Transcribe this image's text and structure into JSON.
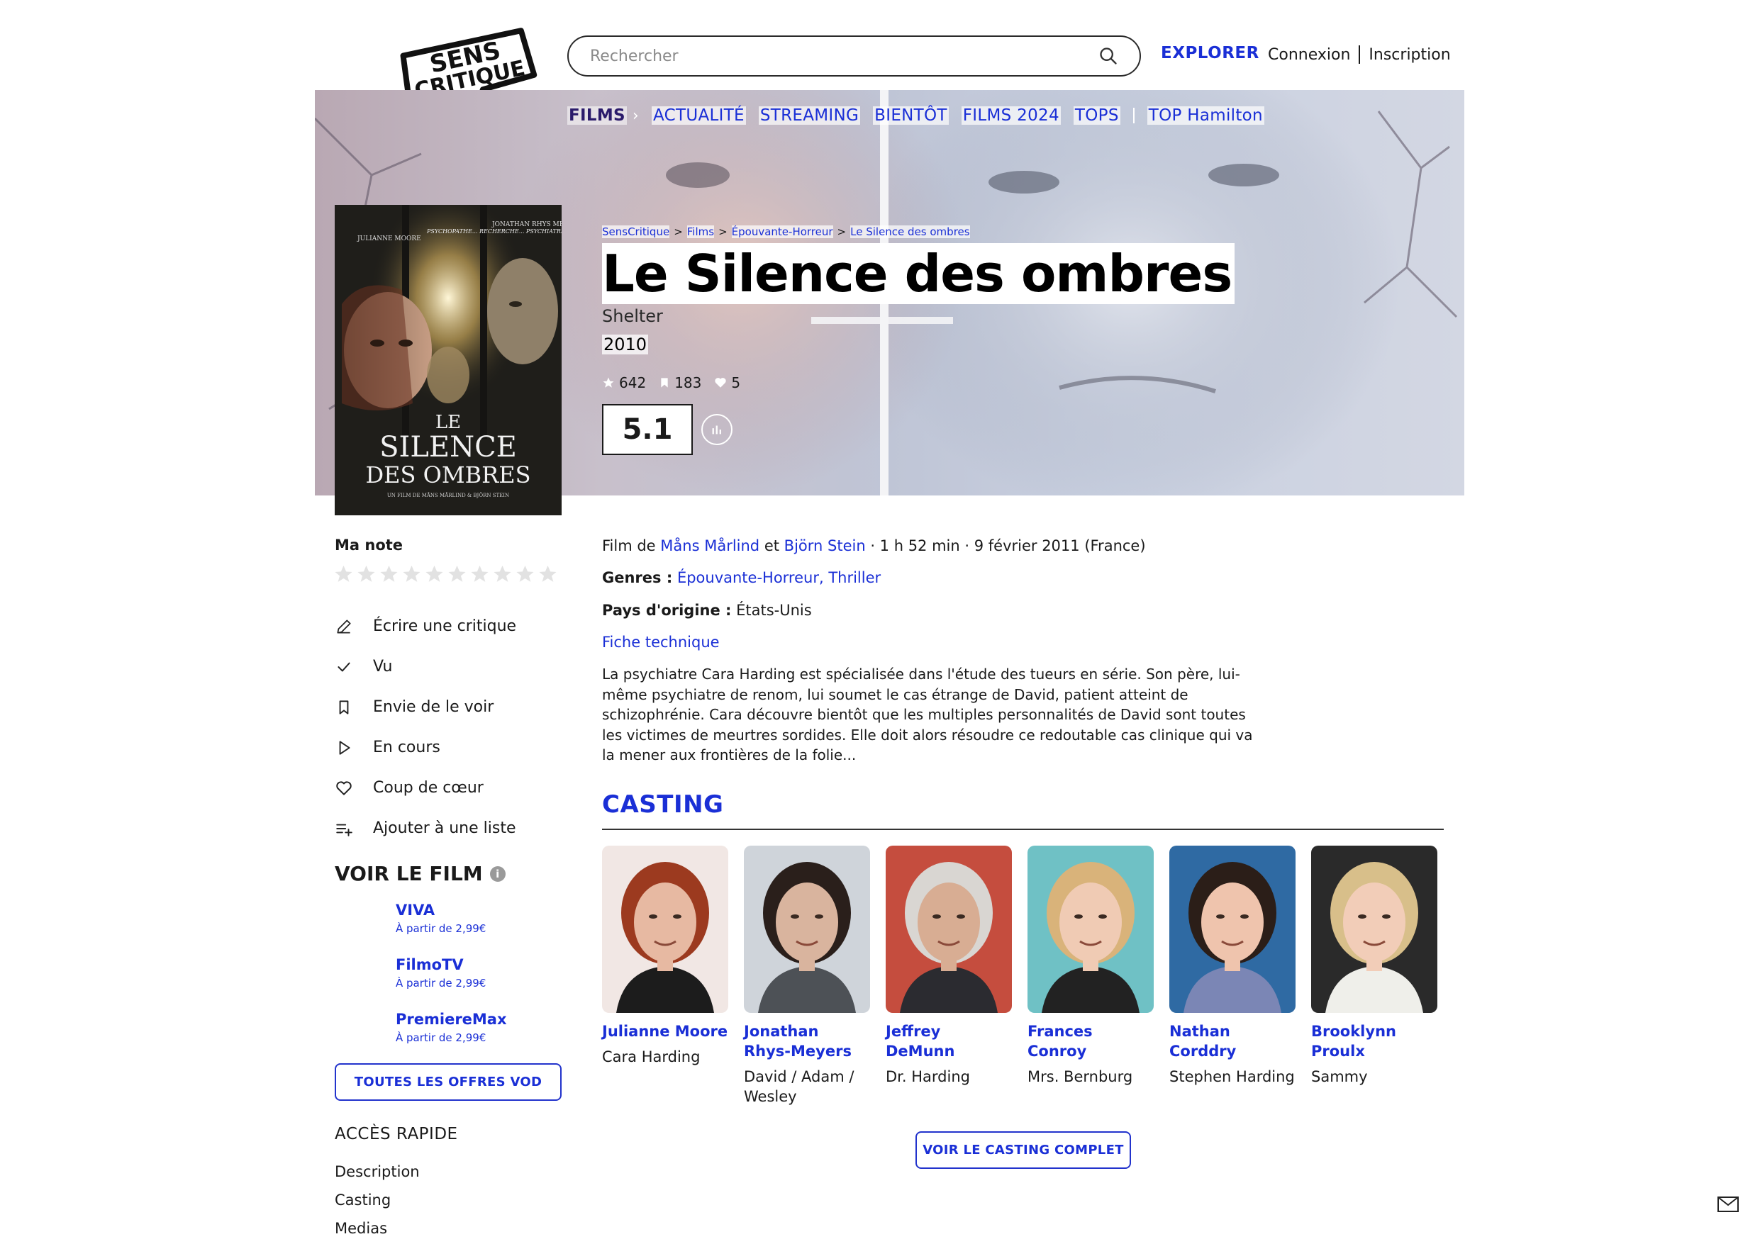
{
  "header": {
    "logo_text": "SENS CRITIQUE",
    "search_placeholder": "Rechercher",
    "explorer": "EXPLORER",
    "login": "Connexion",
    "signup": "Inscription"
  },
  "subnav": {
    "active": "FILMS",
    "items": [
      "ACTUALITÉ",
      "STREAMING",
      "BIENTÔT",
      "FILMS 2024",
      "TOPS",
      "TOP Hamilton"
    ]
  },
  "breadcrumb": [
    "SensCritique",
    "Films",
    "Épouvante-Horreur",
    "Le Silence des ombres"
  ],
  "movie": {
    "title": "Le Silence des ombres",
    "original_title": "Shelter",
    "year": "2010",
    "ratings_count": "642",
    "wishes_count": "183",
    "favorites_count": "5",
    "score": "5.1",
    "directed_prefix": "Film de",
    "director_1": "Måns Mårlind",
    "director_joiner": "et",
    "director_2": "Björn Stein",
    "details": "· 1 h 52 min · 9 février 2011 (France)",
    "genres_label": "Genres :",
    "genres": "Épouvante-Horreur, Thriller",
    "country_label": "Pays d'origine :",
    "country": "États-Unis",
    "fiche_link": "Fiche technique",
    "synopsis": "La psychiatre Cara Harding est spécialisée dans l'étude des tueurs en série. Son père, lui-même psychiatre de renom, lui soumet le cas étrange de David, patient atteint de schizophrénie. Cara découvre bientôt que les multiples personnalités de David sont toutes les victimes de meurtres sordides. Elle doit alors résoudre ce redoutable cas clinique qui va la mener aux frontières de la folie..."
  },
  "poster": {
    "credit_left": "JULIANNE MOORE",
    "credit_right": "JONATHAN RHYS MEYERS",
    "tagline": "PSYCHOPATHE... RECHERCHE... PSYCHIATRE",
    "title_line1": "LE",
    "title_line2": "SILENCE",
    "title_line3": "DES OMBRES",
    "footer": "UN FILM DE MÅNS MÅRLIND & BJÖRN STEIN"
  },
  "sidebar": {
    "ma_note": "Ma note",
    "star_count": 10,
    "actions": [
      {
        "label": "Écrire une critique",
        "icon": "pencil-icon"
      },
      {
        "label": "Vu",
        "icon": "check-icon"
      },
      {
        "label": "Envie de le voir",
        "icon": "bookmark-icon"
      },
      {
        "label": "En cours",
        "icon": "play-icon"
      },
      {
        "label": "Coup de cœur",
        "icon": "heart-icon"
      },
      {
        "label": "Ajouter à une liste",
        "icon": "add-list-icon"
      }
    ],
    "voir_le_film": "VOIR LE FILM",
    "vod": [
      {
        "name": "VIVA",
        "price": "À partir de 2,99€"
      },
      {
        "name": "FilmoTV",
        "price": "À partir de 2,99€"
      },
      {
        "name": "PremiereMax",
        "price": "À partir de 2,99€"
      }
    ],
    "all_offers": "TOUTES LES OFFRES VOD",
    "acces_rapide": "ACCÈS RAPIDE",
    "acces_links": [
      "Description",
      "Casting",
      "Medias"
    ]
  },
  "casting": {
    "title": "CASTING",
    "members": [
      {
        "actor": "Julianne Moore",
        "role": "Cara Harding",
        "skin": "#e7b9a2",
        "hair": "#9c3a1f",
        "bg": "#f1e7e4",
        "shirt": "#1c1c1c"
      },
      {
        "actor": "Jonathan Rhys-Meyers",
        "role": "David / Adam / Wesley",
        "skin": "#d9b49e",
        "hair": "#2a1f1b",
        "bg": "#cfd4da",
        "shirt": "#4d5156"
      },
      {
        "actor": "Jeffrey DeMunn",
        "role": "Dr. Harding",
        "skin": "#d8ad93",
        "hair": "#d9d6d2",
        "bg": "#c54d3e",
        "shirt": "#2b2b30"
      },
      {
        "actor": "Frances Conroy",
        "role": "Mrs. Bernburg",
        "skin": "#f0cbb4",
        "hair": "#d9b37a",
        "bg": "#6fc1c5",
        "shirt": "#222222"
      },
      {
        "actor": "Nathan Corddry",
        "role": "Stephen Harding",
        "skin": "#efc4ad",
        "hair": "#2b1e18",
        "bg": "#2f6aa3",
        "shirt": "#7b86b5"
      },
      {
        "actor": "Brooklynn Proulx",
        "role": "Sammy",
        "skin": "#f2cdb8",
        "hair": "#d8bf8a",
        "bg": "#2a2a2a",
        "shirt": "#efefea"
      }
    ],
    "full_casting": "VOIR LE CASTING COMPLET"
  },
  "colors": {
    "accent": "#1a2fd6",
    "text": "#1a1a1a",
    "star": "#e2e2e2"
  }
}
